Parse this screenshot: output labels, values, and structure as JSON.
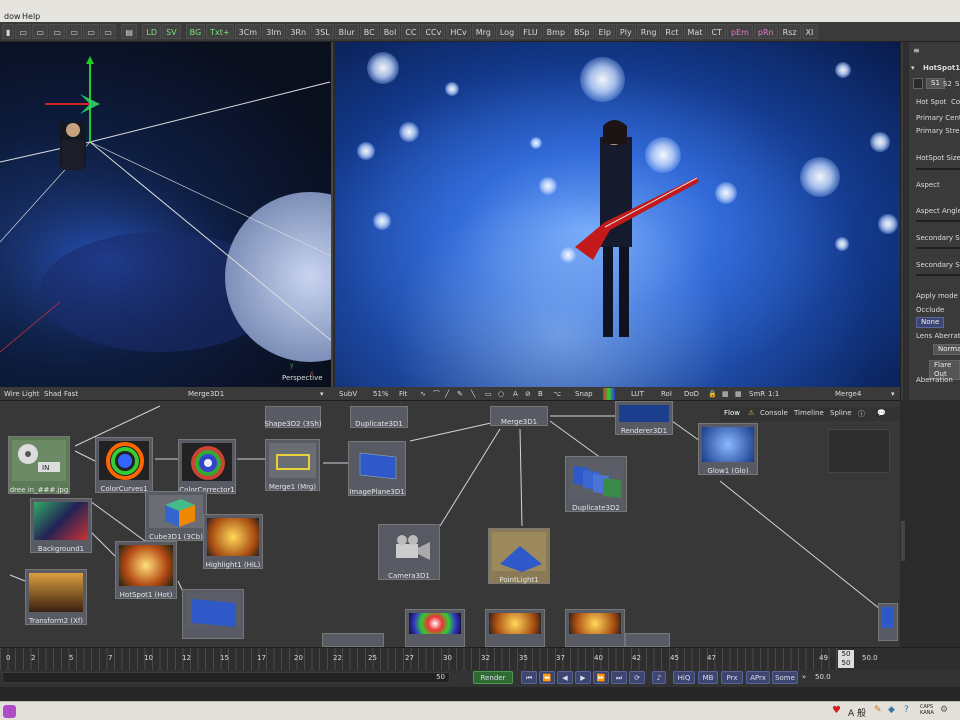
{
  "menubar": {
    "items": [
      "dow",
      "Help"
    ]
  },
  "toolbar": {
    "buttons": [
      "LD",
      "SV",
      "BG",
      "Txt+",
      "3Cm",
      "3Im",
      "3Rn",
      "3SL",
      "Blur",
      "BC",
      "Bol",
      "CC",
      "CCv",
      "HCv",
      "Mrg",
      "Log",
      "FLU",
      "Bmp",
      "BSp",
      "Elp",
      "Ply",
      "Rng",
      "Rct",
      "Mat",
      "CT",
      "pEm",
      "pRn",
      "Rsz",
      "XI"
    ]
  },
  "viewport_left": {
    "label": "Perspective",
    "bar": [
      "Wire",
      "Light",
      "Shad",
      "Fast"
    ],
    "title": "Merge3D1"
  },
  "viewport_right": {
    "bar": {
      "subv": "SubV",
      "zoom": "51%",
      "fit": "Fit",
      "snap": "Snap",
      "lut": "LUT",
      "roi": "RoI",
      "dod": "DoD",
      "smr": "SmR",
      "ratio": "1:1"
    },
    "title": "Merge4"
  },
  "sidepanel": {
    "tool_name": "HotSpot1",
    "subtabs": [
      "S1",
      "S2",
      "S"
    ],
    "tab": "Hot Spot",
    "tab2": "Co",
    "fields": [
      "Primary Cente",
      "Primary Streng",
      "HotSpot Size",
      "Aspect",
      "Aspect Angle",
      "Secondary Str",
      "Secondary Siz",
      "Apply mode",
      "Occlude",
      "Lens Aberrati",
      "Aberration"
    ],
    "occlude_value": "None",
    "lens_value": "Normal",
    "flare_value": "Flare Out"
  },
  "flow": {
    "tabs": [
      "Flow",
      "Console",
      "Timeline",
      "Spline"
    ],
    "nodes": [
      {
        "name": "node-loader",
        "label": "dree in_###.jpg"
      },
      {
        "name": "node-colorcurves",
        "label": "ColorCurves1"
      },
      {
        "name": "node-colorcorrector",
        "label": "ColorCorrector1"
      },
      {
        "name": "node-merge1",
        "label": "Merge1 (Mrg)"
      },
      {
        "name": "node-shape3d",
        "label": "Shape3D2 (3Sh)"
      },
      {
        "name": "node-duplicate3d1",
        "label": "Duplicate3D1"
      },
      {
        "name": "node-merge3d1",
        "label": "Merge3D1"
      },
      {
        "name": "node-renderer3d1",
        "label": "Renderer3D1"
      },
      {
        "name": "node-imageplane",
        "label": "ImagePlane3D1"
      },
      {
        "name": "node-glow",
        "label": "Glow1 (Glo)"
      },
      {
        "name": "node-duplicate3d2",
        "label": "Duplicate3D2"
      },
      {
        "name": "node-background",
        "label": "Background1"
      },
      {
        "name": "node-cube3d",
        "label": "Cube3D1 (3Cb)"
      },
      {
        "name": "node-highlight",
        "label": "Highlight1 (HiL)"
      },
      {
        "name": "node-camera",
        "label": "Camera3D1"
      },
      {
        "name": "node-pointlight",
        "label": "PointLight1"
      },
      {
        "name": "node-hotspot",
        "label": "HotSpot1 (Hot)"
      },
      {
        "name": "node-transform",
        "label": "Transform2 (Xf)"
      }
    ]
  },
  "timeline": {
    "ticks": [
      "0",
      "2",
      "5",
      "7",
      "10",
      "12",
      "15",
      "17",
      "20",
      "22",
      "25",
      "27",
      "30",
      "32",
      "35",
      "37",
      "40",
      "42",
      "45",
      "47",
      "49"
    ],
    "end_a": "50",
    "end_b": "50",
    "end_value": "50.0",
    "current": "50"
  },
  "transport": {
    "render": "Render",
    "buttons": [
      "HiQ",
      "MB",
      "Prx",
      "APrx",
      "Some"
    ],
    "frame": "50.0"
  },
  "taskbar": {
    "caps": "CAPS",
    "kana": "KANA"
  }
}
